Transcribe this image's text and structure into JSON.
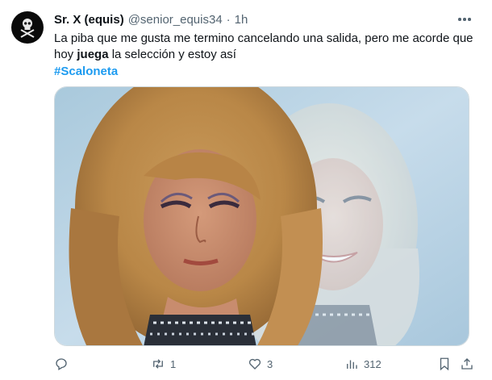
{
  "tweet": {
    "display_name": "Sr. X (equis)",
    "handle": "@senior_equis34",
    "separator": "·",
    "time": "1h",
    "text_part1": "La piba que me gusta me  termino cancelando una salida, pero me acorde que hoy ",
    "text_bold": "juega",
    "text_part2": " la selección y estoy así",
    "hashtag": "#Scaloneta"
  },
  "metrics": {
    "retweets": "1",
    "likes": "3",
    "views": "312"
  },
  "icons": {
    "avatar": "avatar-skull-icon",
    "more": "more-horizontal-icon",
    "reply": "reply-icon",
    "retweet": "retweet-icon",
    "like": "heart-icon",
    "views": "views-icon",
    "bookmark": "bookmark-icon",
    "share": "share-icon"
  },
  "colors": {
    "accent": "#1d9bf0",
    "text": "#0f1419",
    "secondary": "#536471"
  }
}
